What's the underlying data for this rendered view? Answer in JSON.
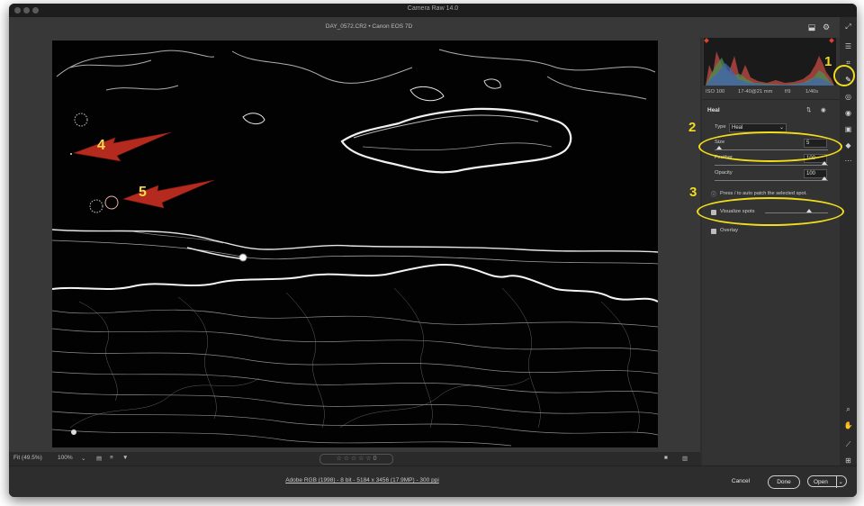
{
  "window": {
    "title": "Camera Raw 14.0"
  },
  "toolbar": {
    "filename": "DAY_0572.CR2  •  Canon EOS 7D"
  },
  "histogram": {
    "camera_info": {
      "iso": "ISO 100",
      "lens": "17-40@21 mm",
      "aperture": "f/9",
      "shutter": "1/40s"
    }
  },
  "panel": {
    "section_title": "Heal",
    "type_label": "Type",
    "type_value": "Heal",
    "size_label": "Size",
    "size_value": "5",
    "feather_label": "Feather",
    "feather_value": "100",
    "opacity_label": "Opacity",
    "opacity_value": "100",
    "hint_text": "Press / to auto patch the selected spot.",
    "visualize_spots_label": "Visualize spots",
    "overlay_label": "Overlay"
  },
  "annotations": {
    "a1": "1",
    "a2": "2",
    "a3": "3",
    "a4": "4",
    "a5": "5"
  },
  "filmstrip": {
    "fit_label": "Fit (49.5%)",
    "zoom_label": "100%",
    "zoom_chevron": "⌄",
    "stars": "☆ ☆ ☆ ☆ ☆",
    "rating_count": "0"
  },
  "bottom": {
    "workflow_link": "Adobe RGB (1998) - 8 bit - 5184 x 3456 (17.9MP) - 300 ppi",
    "cancel_label": "Cancel",
    "done_label": "Done",
    "open_label": "Open",
    "open_chevron": "⌄"
  },
  "icons": [
    "save-icon",
    "settings-icon",
    "expand-icon",
    "edit-sliders-icon",
    "crop-icon",
    "healing-icon",
    "mask-icon",
    "redeye-icon",
    "presets-icon",
    "more-icon",
    "zoom-icon",
    "hand-icon",
    "eyedropper-icon",
    "grid-icon",
    "filter-icon",
    "sort-icon",
    "compare-icon",
    "before-after-icon",
    "swap-icon",
    "toggle-icon"
  ],
  "colors": {
    "accent_annotation": "#f1dc1e",
    "arrow_red": "#b52a1e",
    "panel_bg": "#333333"
  }
}
